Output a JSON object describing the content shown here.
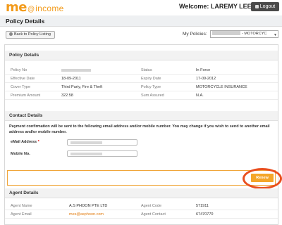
{
  "header": {
    "logo_me": "me",
    "logo_at": "@",
    "logo_income": "income",
    "welcome": "Welcome: LAREMY LEE",
    "logout_label": "Logout"
  },
  "title": "Policy Details",
  "toolbar": {
    "back_label": "Back to Policy Listing",
    "policies_label": "My Policies:",
    "policies_selected": "- MOTORCYC"
  },
  "policy_details": {
    "heading": "Policy Details",
    "rows": [
      {
        "l1": "Policy No",
        "v1": "",
        "l2": "Status",
        "v2": "In Force"
      },
      {
        "l1": "Effective Date",
        "v1": "18-09-2011",
        "l2": "Expiry Date",
        "v2": "17-09-2012"
      },
      {
        "l1": "Cover Type",
        "v1": "Third Party, Fire & Theft",
        "l2": "Policy Type",
        "v2": "MOTORCYCLE INSURANCE"
      },
      {
        "l1": "Premium Amount",
        "v1": "322.58",
        "l2": "Sum Assured",
        "v2": "N.A."
      }
    ]
  },
  "contact_details": {
    "heading": "Contact Details",
    "note": "Payment confirmation will be sent to the following email address and/or mobile number. You may change if you wish to send to another email address and/or mobile number.",
    "email_label": "eMail Address",
    "required_mark": "*",
    "mobile_label": "Mobile No."
  },
  "renew_label": "Renew",
  "agent_details": {
    "heading": "Agent Details",
    "rows": [
      {
        "l1": "Agent Name",
        "v1": "A.S PHOON PTE LTD",
        "l2": "Agent Code",
        "v2": "571911"
      },
      {
        "l1": "Agent Email",
        "v1": "mes@asphoon.com",
        "l2": "Agent Contact",
        "v2": "67470770"
      }
    ]
  },
  "colors": {
    "brand_orange": "#f29a1a",
    "renew_button": "#f4a629",
    "highlight_circle": "#e94f1e"
  }
}
